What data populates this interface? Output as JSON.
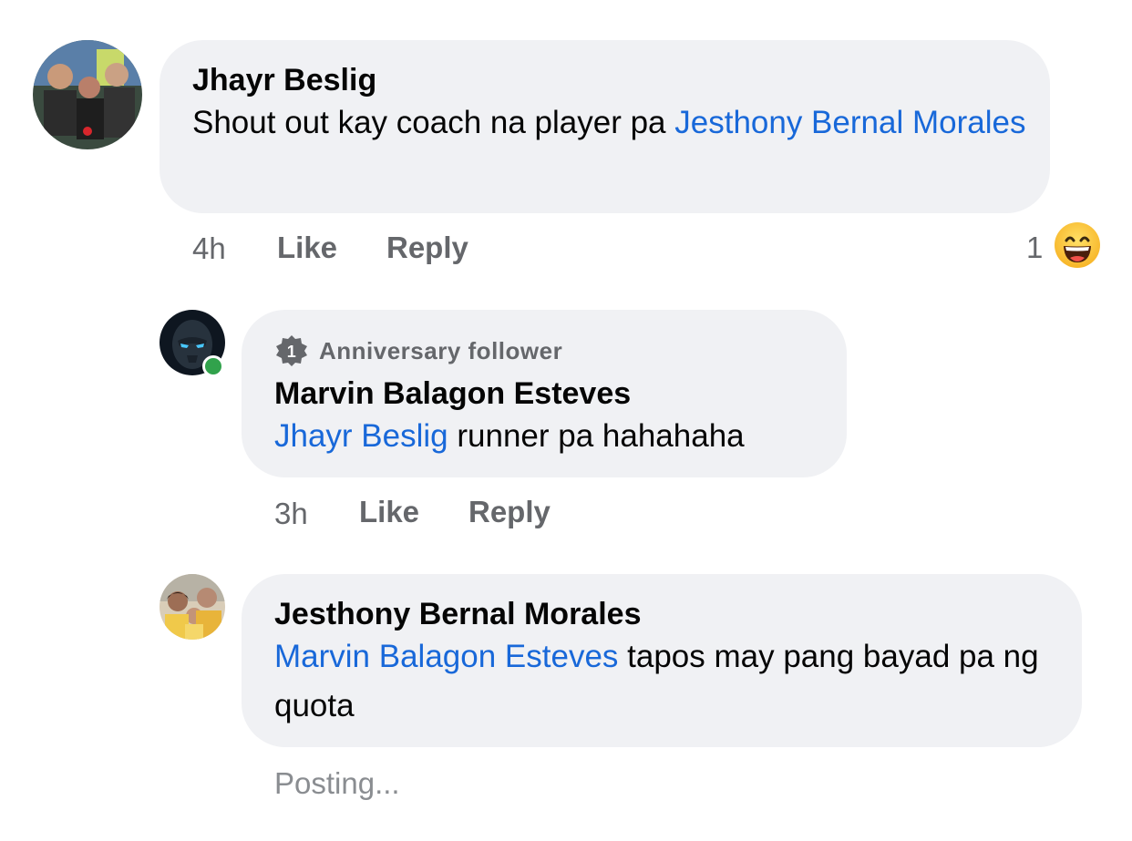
{
  "comments": [
    {
      "author": "Jhayr Beslig",
      "text_before": "Shout out kay coach na player pa ",
      "mention": "Jesthony Bernal Morales",
      "time": "4h",
      "like_label": "Like",
      "reply_label": "Reply",
      "reaction_count": "1",
      "reaction_icon": "laughing-emoji-icon"
    },
    {
      "badge": "Anniversary follower",
      "badge_number": "1",
      "author": "Marvin Balagon Esteves",
      "mention": "Jhayr Beslig",
      "text_after": " runner pa hahahaha",
      "time": "3h",
      "like_label": "Like",
      "reply_label": "Reply",
      "online": true
    },
    {
      "author": "Jesthony Bernal Morales",
      "mention": "Marvin Balagon Esteves",
      "text_after": " tapos may pang bayad pa ng quota",
      "status": "Posting..."
    }
  ],
  "colors": {
    "bubble": "#f0f1f4",
    "mention": "#1868d9",
    "meta": "#65676b",
    "online": "#31a24c"
  }
}
